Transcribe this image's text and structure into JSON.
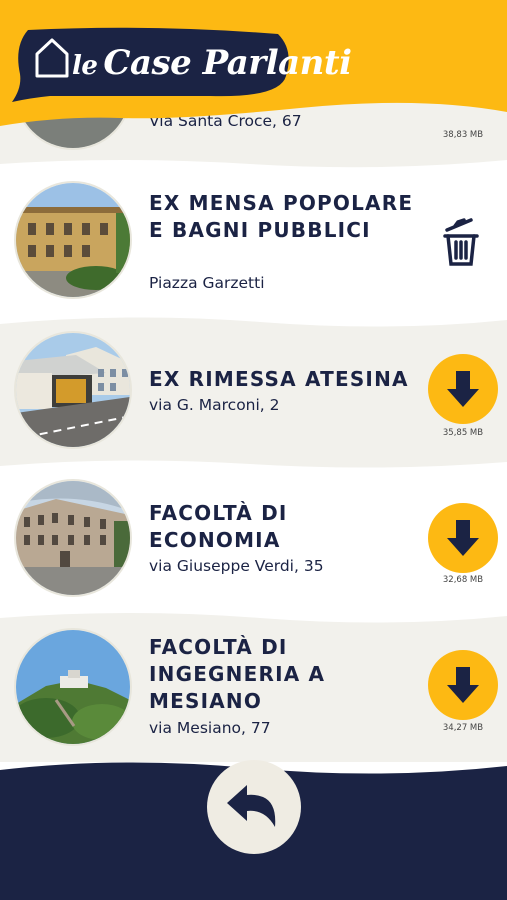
{
  "app": {
    "brand_prefix": "le",
    "brand_name": "Case Parlanti",
    "colors": {
      "accent": "#fdb913",
      "navy": "#1b2344",
      "band": "#f2f1ec"
    }
  },
  "list": {
    "items": [
      {
        "title": "",
        "address": "Via Santa Croce, 67",
        "size": "38,83 MB",
        "action_icon": "download-icon"
      },
      {
        "title": "EX MENSA POPOLARE E BAGNI PUBBLICI",
        "address": "Piazza Garzetti",
        "size": "",
        "action_icon": "trash-icon"
      },
      {
        "title": "EX RIMESSA ATESINA",
        "address": "via G. Marconi, 2",
        "size": "35,85 MB",
        "action_icon": "download-icon"
      },
      {
        "title": "FACOLTÀ DI ECONOMIA",
        "address": "via Giuseppe Verdi, 35",
        "size": "32,68 MB",
        "action_icon": "download-icon"
      },
      {
        "title": "FACOLTÀ DI INGEGNERIA A MESIANO",
        "address": "via Mesiano, 77",
        "size": "34,27 MB",
        "action_icon": "download-icon"
      }
    ]
  },
  "footer": {
    "back_icon": "back-arrow-icon"
  }
}
